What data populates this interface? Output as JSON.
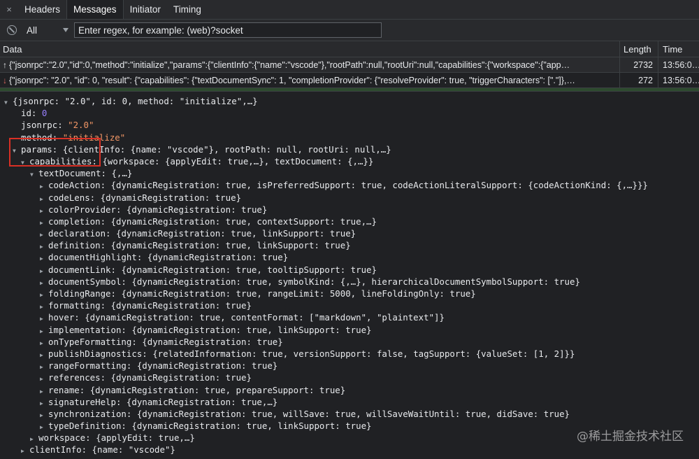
{
  "tabs": {
    "close": "×",
    "items": [
      "Headers",
      "Messages",
      "Initiator",
      "Timing"
    ]
  },
  "filter": {
    "select_value": "All",
    "placeholder": "Enter regex, for example: (web)?socket"
  },
  "table": {
    "headers": [
      "Data",
      "Length",
      "Time"
    ],
    "rows": [
      {
        "dir": "↑",
        "data": "{\"jsonrpc\":\"2.0\",\"id\":0,\"method\":\"initialize\",\"params\":{\"clientInfo\":{\"name\":\"vscode\"},\"rootPath\":null,\"rootUri\":null,\"capabilities\":{\"workspace\":{\"app…",
        "length": "2732",
        "time": "13:56:0…"
      },
      {
        "dir": "↓",
        "data": "{\"jsonrpc\": \"2.0\", \"id\": 0, \"result\": {\"capabilities\": {\"textDocumentSync\": 1, \"completionProvider\": {\"resolveProvider\": true, \"triggerCharacters\": [\".\"]},…",
        "length": "272",
        "time": "13:56:0…"
      }
    ]
  },
  "tree": {
    "root": "{jsonrpc: \"2.0\", id: 0, method: \"initialize\",…}",
    "id_key": "id: ",
    "id_val": "0",
    "jsonrpc_key": "jsonrpc: ",
    "jsonrpc_val": "\"2.0\"",
    "method_key": "method: ",
    "method_val": "\"initialize\"",
    "params_key": "params: ",
    "params_summary": "{clientInfo: {name: \"vscode\"}, rootPath: null, rootUri: null,…}",
    "capabilities_key": "capabilities: ",
    "capabilities_summary": "{workspace: {applyEdit: true,…}, textDocument: {,…}}",
    "textdocument_key": "textDocument: ",
    "textdocument_summary": "{,…}",
    "items": [
      {
        "key": "codeAction: ",
        "summary": "{dynamicRegistration: true, isPreferredSupport: true, codeActionLiteralSupport: {codeActionKind: {,…}}}"
      },
      {
        "key": "codeLens: ",
        "summary": "{dynamicRegistration: true}"
      },
      {
        "key": "colorProvider: ",
        "summary": "{dynamicRegistration: true}"
      },
      {
        "key": "completion: ",
        "summary": "{dynamicRegistration: true, contextSupport: true,…}"
      },
      {
        "key": "declaration: ",
        "summary": "{dynamicRegistration: true, linkSupport: true}"
      },
      {
        "key": "definition: ",
        "summary": "{dynamicRegistration: true, linkSupport: true}"
      },
      {
        "key": "documentHighlight: ",
        "summary": "{dynamicRegistration: true}"
      },
      {
        "key": "documentLink: ",
        "summary": "{dynamicRegistration: true, tooltipSupport: true}"
      },
      {
        "key": "documentSymbol: ",
        "summary": "{dynamicRegistration: true, symbolKind: {,…}, hierarchicalDocumentSymbolSupport: true}"
      },
      {
        "key": "foldingRange: ",
        "summary": "{dynamicRegistration: true, rangeLimit: 5000, lineFoldingOnly: true}"
      },
      {
        "key": "formatting: ",
        "summary": "{dynamicRegistration: true}"
      },
      {
        "key": "hover: ",
        "summary": "{dynamicRegistration: true, contentFormat: [\"markdown\", \"plaintext\"]}"
      },
      {
        "key": "implementation: ",
        "summary": "{dynamicRegistration: true, linkSupport: true}"
      },
      {
        "key": "onTypeFormatting: ",
        "summary": "{dynamicRegistration: true}"
      },
      {
        "key": "publishDiagnostics: ",
        "summary": "{relatedInformation: true, versionSupport: false, tagSupport: {valueSet: [1, 2]}}"
      },
      {
        "key": "rangeFormatting: ",
        "summary": "{dynamicRegistration: true}"
      },
      {
        "key": "references: ",
        "summary": "{dynamicRegistration: true}"
      },
      {
        "key": "rename: ",
        "summary": "{dynamicRegistration: true, prepareSupport: true}"
      },
      {
        "key": "signatureHelp: ",
        "summary": "{dynamicRegistration: true,…}"
      },
      {
        "key": "synchronization: ",
        "summary": "{dynamicRegistration: true, willSave: true, willSaveWaitUntil: true, didSave: true}"
      },
      {
        "key": "typeDefinition: ",
        "summary": "{dynamicRegistration: true, linkSupport: true}"
      }
    ],
    "workspace_key": "workspace: ",
    "workspace_summary": "{applyEdit: true,…}",
    "clientinfo_key": "clientInfo: ",
    "clientinfo_summary": "{name: \"vscode\"}"
  },
  "watermark": "@稀土掘金技术社区",
  "colors": {
    "number": "#9980ff",
    "string": "#f29766",
    "highlight": "#d93025"
  }
}
